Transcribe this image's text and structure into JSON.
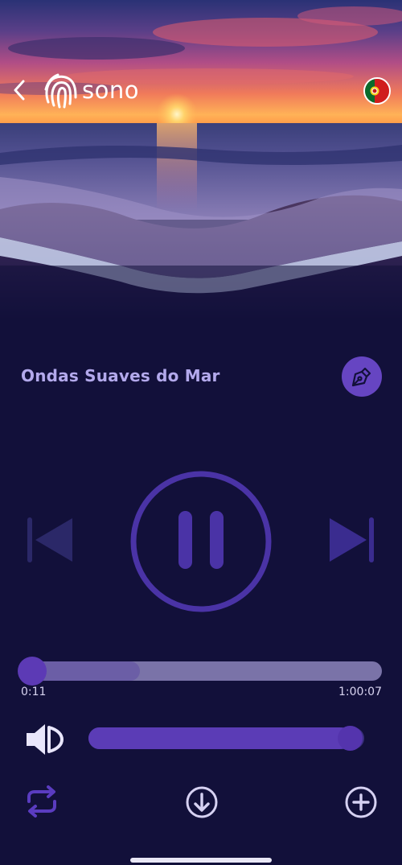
{
  "header": {
    "app_name": "sono",
    "back_icon": "chevron-left-icon",
    "logo_icon": "fingerprint-icon",
    "language_flag": "portugal-flag-icon"
  },
  "player": {
    "track_title": "Ondas Suaves do Mar",
    "edit_icon": "pen-nib-icon",
    "controls": {
      "previous_icon": "skip-previous-icon",
      "play_pause_icon": "pause-icon",
      "next_icon": "skip-next-icon"
    },
    "progress": {
      "current_time": "0:11",
      "total_time": "1:00:07",
      "played_fraction": 0.003,
      "buffered_fraction": 0.33
    },
    "volume": {
      "icon": "volume-half-icon",
      "level_fraction": 0.95
    },
    "actions": {
      "repeat_icon": "repeat-icon",
      "download_icon": "download-circle-icon",
      "add_icon": "add-circle-icon"
    }
  },
  "colors": {
    "background": "#12103a",
    "accent": "#6645c2",
    "title": "#b3a9ec",
    "control_inactive": "#2b2868",
    "control_active": "#4a33a6"
  }
}
